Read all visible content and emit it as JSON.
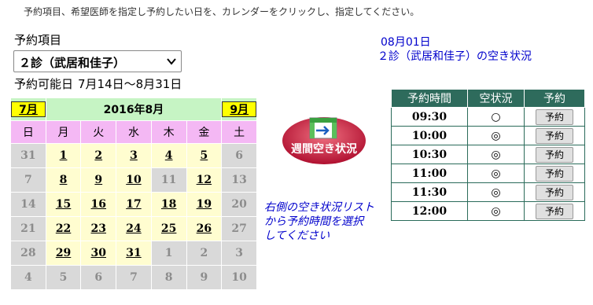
{
  "instruction": "予約項目、希望医師を指定し予約したい日を、カレンダーをクリックし、指定してください。",
  "item_label": "予約項目",
  "doctor_select": {
    "value": "２診（武居和佳子）"
  },
  "period": {
    "label": "予約可能日",
    "range": "7月14日～8月31日"
  },
  "calendar": {
    "prev_month": "7月",
    "title": "2016年8月",
    "next_month": "9月",
    "weekdays": [
      "日",
      "月",
      "火",
      "水",
      "木",
      "金",
      "土"
    ],
    "weeks": [
      [
        "31",
        "1",
        "2",
        "3",
        "4",
        "5",
        "6"
      ],
      [
        "7",
        "8",
        "9",
        "10",
        "11",
        "12",
        "13"
      ],
      [
        "14",
        "15",
        "16",
        "17",
        "18",
        "19",
        "20"
      ],
      [
        "21",
        "22",
        "23",
        "24",
        "25",
        "26",
        "27"
      ],
      [
        "28",
        "29",
        "30",
        "31",
        "1",
        "2",
        "3"
      ],
      [
        "4",
        "5",
        "6",
        "7",
        "8",
        "9",
        "10"
      ]
    ]
  },
  "weekly_button": {
    "label": "週間空き状況"
  },
  "guide_text": [
    "右側の空き状況リスト",
    "から予約時間を選択",
    "してください"
  ],
  "selected_info": {
    "date": "08月01日",
    "subtitle": "２診（武居和佳子）の空き状況"
  },
  "slot_table": {
    "headers": [
      "予約時間",
      "空状況",
      "予約"
    ],
    "rows": [
      {
        "time": "09:30",
        "status": "○",
        "button": "予約"
      },
      {
        "time": "10:00",
        "status": "◎",
        "button": "予約"
      },
      {
        "time": "10:30",
        "status": "◎",
        "button": "予約"
      },
      {
        "time": "11:00",
        "status": "◎",
        "button": "予約"
      },
      {
        "time": "11:30",
        "status": "◎",
        "button": "予約"
      },
      {
        "time": "12:00",
        "status": "◎",
        "button": "予約"
      }
    ]
  }
}
